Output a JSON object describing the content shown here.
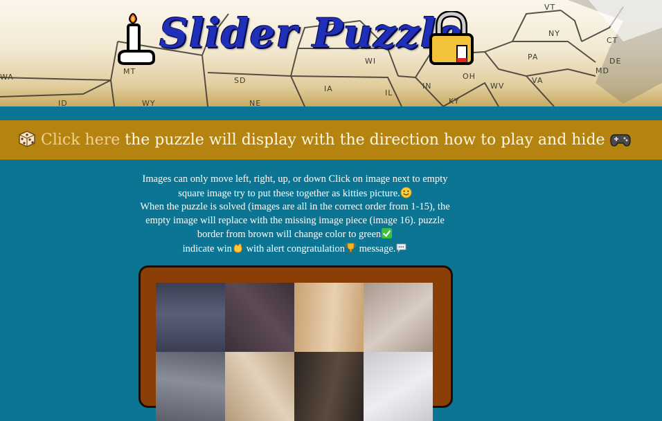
{
  "header": {
    "title": "Slider Puzzle",
    "states": [
      "WA",
      "MT",
      "ID",
      "WY",
      "SD",
      "NE",
      "IA",
      "IL",
      "IN",
      "WI",
      "OH",
      "KY",
      "WV",
      "VA",
      "PA",
      "NY",
      "VT",
      "CT",
      "MD",
      "DE"
    ]
  },
  "banner": {
    "link_text": "Click here",
    "rest_text": " the puzzle will display with the direction how to play and hide",
    "left_icon": "die-icon",
    "right_icon": "gamepad-icon"
  },
  "instructions": {
    "part1": "Images can only move left, right, up, or down Click on image next to empty square image try to put these together as kitties picture.",
    "part2": "When the puzzle is solved (images are all in the correct order from 1-15), the empty image will replace with the missing image piece (image 16). puzzle border from brown will change color to green",
    "part3": "indicate win",
    "part4": " with alert congratulation",
    "part5": " message."
  },
  "puzzle": {
    "border_color": "#8b3f06",
    "tiles": [
      {
        "icon": "kitten-photo-tile",
        "colors": [
          "#3b3e52",
          "#5a5f79"
        ]
      },
      {
        "icon": "kitten-photo-tile",
        "colors": [
          "#3d3038",
          "#5c4a55"
        ]
      },
      {
        "icon": "kitten-photo-tile",
        "colors": [
          "#c9a173",
          "#e8d1b0"
        ]
      },
      {
        "icon": "kitten-photo-tile",
        "colors": [
          "#a8998e",
          "#d9ccc4"
        ]
      },
      {
        "icon": "kitten-photo-tile",
        "colors": [
          "#5d606b",
          "#8a8e99"
        ]
      },
      {
        "icon": "kitten-photo-tile",
        "colors": [
          "#b49a7a",
          "#e3d2bb"
        ]
      },
      {
        "icon": "kitten-photo-tile",
        "colors": [
          "#2a2421",
          "#5c4b3d"
        ]
      },
      {
        "icon": "kitten-photo-tile",
        "colors": [
          "#c9c9cf",
          "#eeeef2"
        ]
      }
    ]
  }
}
